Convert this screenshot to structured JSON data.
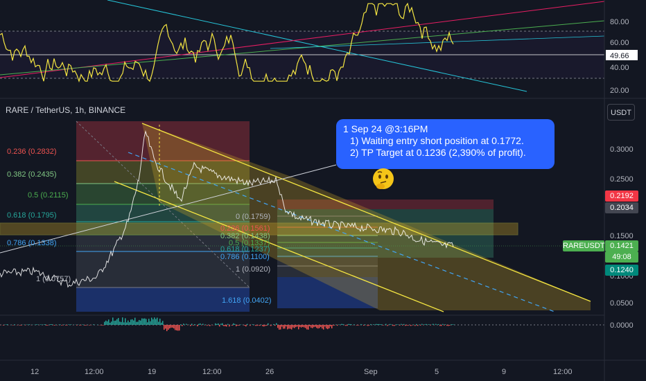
{
  "header": {
    "symbol_title": "RARE / TetherUS, 1h, BINANCE",
    "currency_button": "USDT"
  },
  "callout": {
    "line1": "1 Sep 24 @3:16PM",
    "line2": "1) Waiting entry short position at 0.1772.",
    "line3": "2) TP Target at 0.1236 (2,390% of profit)."
  },
  "emoji": "thinking-face-emoji",
  "rsi_panel": {
    "ticks": [
      "80.00",
      "60.00",
      "40.00",
      "20.00"
    ],
    "current_value": "49.66"
  },
  "price_axis": {
    "ticks": [
      "0.3000",
      "0.2500",
      "0.1500",
      "0.1000",
      "0.0500"
    ],
    "tags": {
      "red": "0.2192",
      "grey": "0.2034",
      "current": "0.1421",
      "countdown": "49:08",
      "teal": "0.1240"
    },
    "symbol_tag": "RAREUSDT"
  },
  "macd_axis": {
    "tick": "0.0000"
  },
  "time_axis": {
    "ticks": [
      "12",
      "12:00",
      "19",
      "12:00",
      "26",
      "Sep",
      "5",
      "9",
      "12:00"
    ]
  },
  "fib_left": [
    "0.236 (0.2832)",
    "0.382 (0.2435)",
    "0.5 (0.2115)",
    "0.618 (0.1795)",
    "0.786 (0.1338)",
    "1 (0.0757)",
    "1.618 (0.0402)"
  ],
  "fib_right": [
    "0 (0.1759)",
    "0.236 (0.1561)",
    "0.382 (0.1438)",
    "0.5 (0.1337)",
    "0.618 (0.1237)",
    "0.786 (0.1100)",
    "1 (0.0920)"
  ],
  "colors": {
    "background": "#131722",
    "yellow": "#f5e642",
    "blue_callout": "#2962ff",
    "green": "#4caf50",
    "red": "#f23645",
    "rsi": "#f5e642"
  },
  "chart_data": {
    "type": "line",
    "title": "RARE / TetherUS, 1h, BINANCE",
    "x": [
      "12",
      "12:00",
      "19",
      "12:00",
      "26",
      "Sep",
      "5",
      "9",
      "12:00"
    ],
    "series": [
      {
        "name": "RAREUSDT",
        "values": [
          0.0757,
          0.076,
          0.28,
          0.25,
          0.245,
          0.16,
          0.15,
          0.142
        ]
      }
    ],
    "ylim": [
      0.04,
      0.34
    ],
    "yscale": "log",
    "rsi_ylim": [
      10,
      90
    ]
  }
}
